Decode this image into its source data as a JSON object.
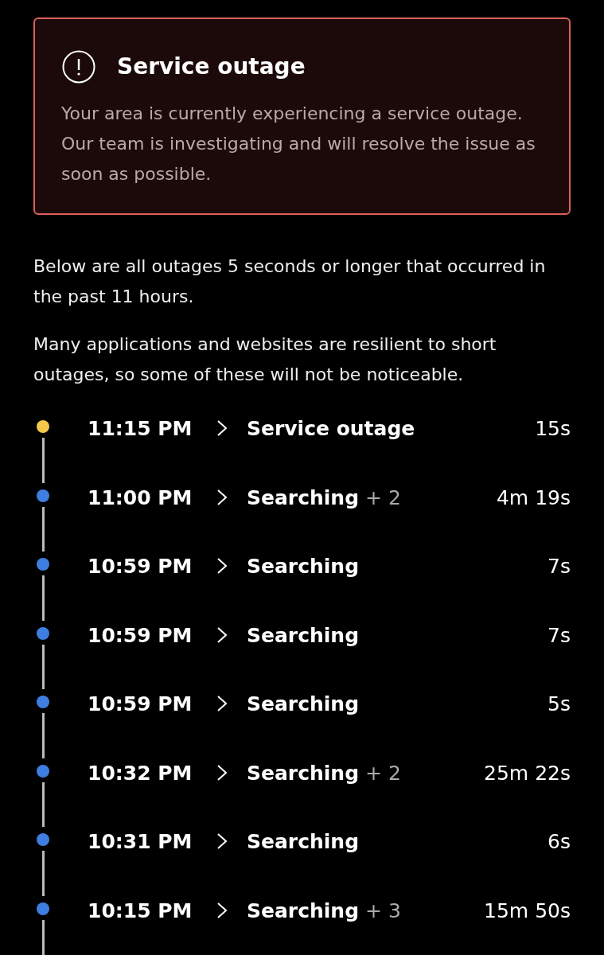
{
  "alert": {
    "title": "Service outage",
    "message": "Your area is currently experiencing a service outage. Our team is investigating and will resolve the issue as soon as possible."
  },
  "intro": [
    "Below are all outages 5 seconds or longer that occurred in the past 11 hours.",
    "Many applications and websites are resilient to short outages, so some of these will not be noticeable."
  ],
  "events": [
    {
      "time": "11:15 PM",
      "status": "Service outage",
      "duration": "15s",
      "color": "#f5c84b"
    },
    {
      "time": "11:00 PM",
      "status": "Searching",
      "extra": "+ 2",
      "duration": "4m 19s",
      "color": "#3f7ee0"
    },
    {
      "time": "10:59 PM",
      "status": "Searching",
      "duration": "7s",
      "color": "#3f7ee0"
    },
    {
      "time": "10:59 PM",
      "status": "Searching",
      "duration": "7s",
      "color": "#3f7ee0"
    },
    {
      "time": "10:59 PM",
      "status": "Searching",
      "duration": "5s",
      "color": "#3f7ee0"
    },
    {
      "time": "10:32 PM",
      "status": "Searching",
      "extra": "+ 2",
      "duration": "25m 22s",
      "color": "#3f7ee0"
    },
    {
      "time": "10:31 PM",
      "status": "Searching",
      "duration": "6s",
      "color": "#3f7ee0"
    },
    {
      "time": "10:15 PM",
      "status": "Searching",
      "extra": "+ 3",
      "duration": "15m 50s",
      "color": "#3f7ee0"
    }
  ]
}
